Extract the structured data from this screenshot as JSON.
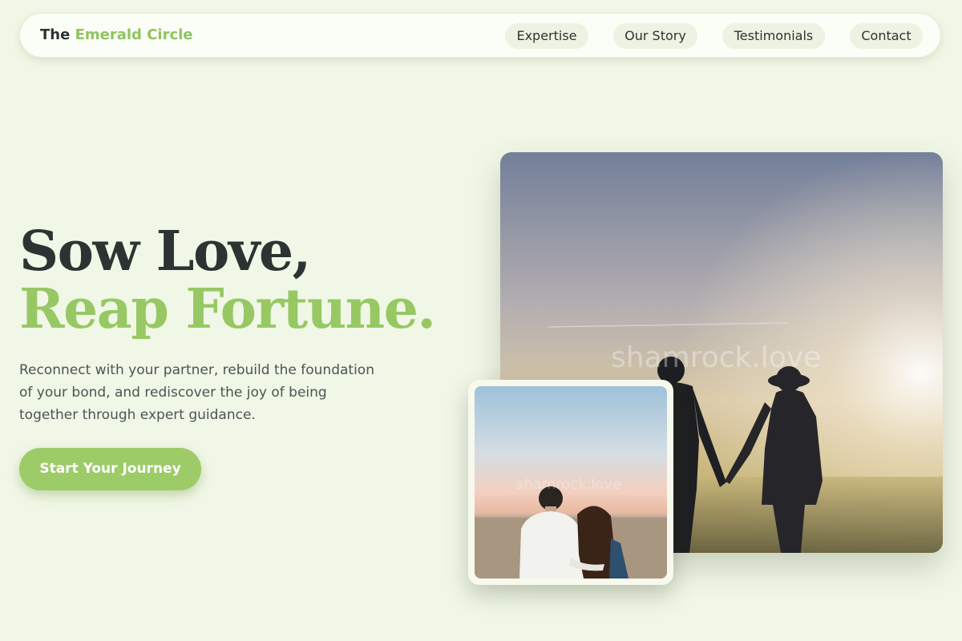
{
  "brand": {
    "prefix": "The",
    "highlight": "Emerald Circle"
  },
  "nav": {
    "links": [
      {
        "label": "Expertise"
      },
      {
        "label": "Our Story"
      },
      {
        "label": "Testimonials"
      },
      {
        "label": "Contact"
      }
    ]
  },
  "hero": {
    "title_line1": "Sow Love,",
    "title_line2": "Reap Fortune.",
    "subtitle": "Reconnect with your partner, rebuild the foundation of your bond, and rediscover the joy of being together through expert guidance.",
    "cta_label": "Start Your Journey"
  },
  "images": {
    "main_watermark": "shamrock.love",
    "inset_watermark": "shamrock.love"
  },
  "colors": {
    "background": "#f1f7e6",
    "accent": "#97c864",
    "text": "#2c3333"
  }
}
